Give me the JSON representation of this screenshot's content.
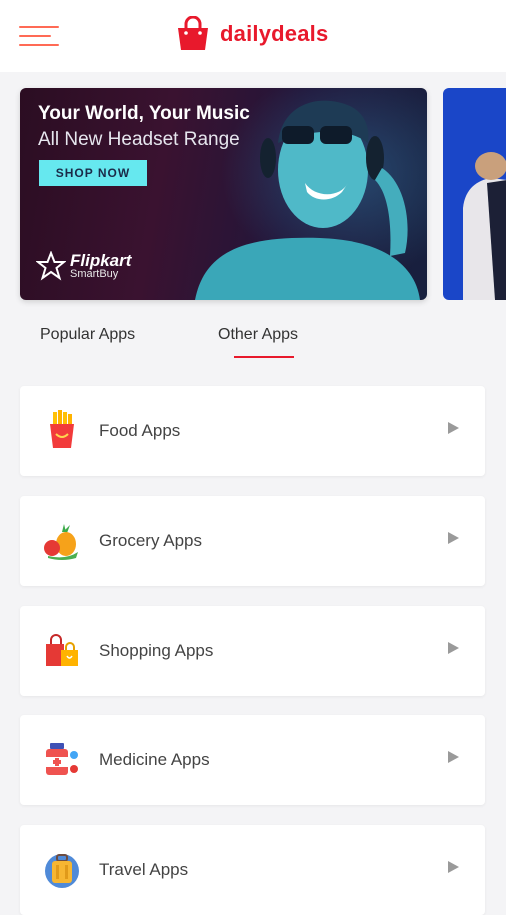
{
  "header": {
    "brand": "dailydeals",
    "menu_icon": "hamburger-menu-icon",
    "logo_icon": "shopping-bag-icon",
    "accent": "#e8192c"
  },
  "banner": {
    "title": "Your World, Your Music",
    "subtitle": "All New Headset Range",
    "cta": "SHOP NOW",
    "logo_name": "Flipkart",
    "logo_sub": "SmartBuy"
  },
  "tabs": [
    {
      "label": "Popular Apps",
      "active": false
    },
    {
      "label": "Other Apps",
      "active": true
    }
  ],
  "categories": [
    {
      "label": "Food Apps",
      "icon": "french-fries-icon"
    },
    {
      "label": "Grocery Apps",
      "icon": "fruits-icon"
    },
    {
      "label": "Shopping Apps",
      "icon": "shopping-bags-icon"
    },
    {
      "label": "Medicine Apps",
      "icon": "medicine-icon"
    },
    {
      "label": "Travel Apps",
      "icon": "luggage-icon"
    }
  ]
}
